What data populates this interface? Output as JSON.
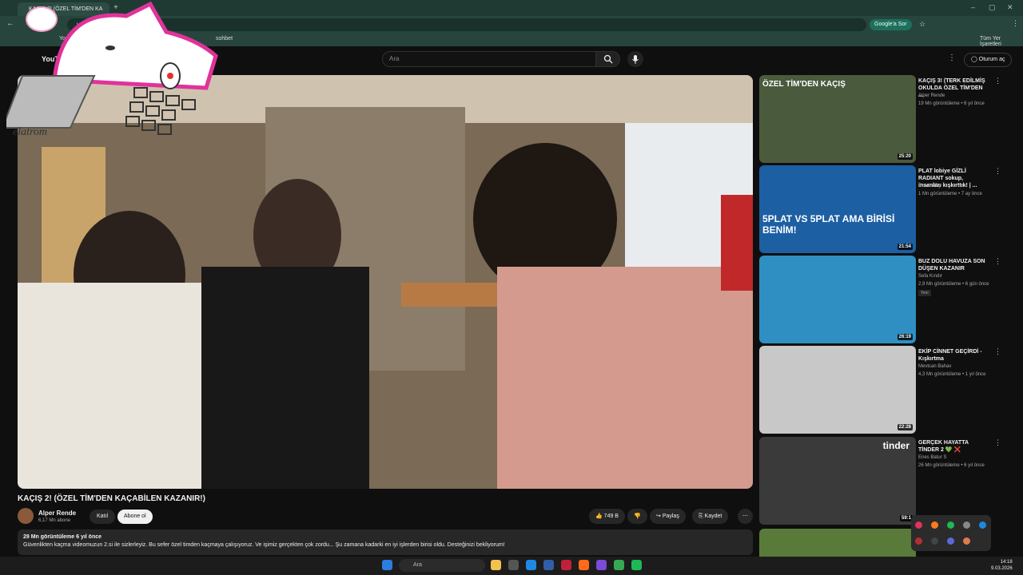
{
  "browser": {
    "tab_title": "KAÇIŞ 2! (ÖZEL TİM'DEN KA",
    "new_tab": "+",
    "url": "youtube",
    "google_sor": "Google'a Sor",
    "bookmarks": [
      "YouTube",
      "sohbet",
      "Tüm Yer İşaretleri"
    ]
  },
  "yt": {
    "logo": "YouTube",
    "search_placeholder": "Ara",
    "signin": "Oturum aç"
  },
  "overlay": {
    "text": "elatrom"
  },
  "video": {
    "title": "KAÇIŞ 2! (ÖZEL TİM'DEN KAÇABİLEN KAZANIR!)",
    "channel": "Alper Rende",
    "subs": "6,17 Mn abone",
    "join": "Katıl",
    "subscribe": "Abone ol",
    "likes": "749 B",
    "share": "Paylaş",
    "save": "Kaydet",
    "stats": "29 Mn görüntüleme  6 yıl önce",
    "description": "Güvenlikten kaçma videomuzun 2.si ile sizlerleyiz. Bu sefer özel timden kaçmaya çalışıyoruz. Ve işimiz gerçekten çok zordu... Şu zamana kadarki en iyi işlerden birisi oldu. Desteğinizi bekliyorum!"
  },
  "recommendations": [
    {
      "title": "KAÇIŞ 3! (TERK EDİLMİŞ OKULDA ÖZEL TİM'DEN ...",
      "channel": "Alper Rende",
      "meta": "19 Mn görüntüleme • 6 yıl önce",
      "duration": "25:20",
      "thumb_text": "ÖZEL TİM'DEN KAÇIŞ",
      "color": "#4a5a3c"
    },
    {
      "title": "PLAT lobiye GİZLİ RADIANT sokup, insanları kışkırttık! | ...",
      "channel": "CombatRy",
      "meta": "1 Mn görüntüleme • 7 ay önce",
      "duration": "21:54",
      "thumb_text": "5PLAT VS 5PLAT AMA BİRİSİ BENİM!",
      "color": "#1d5fa3"
    },
    {
      "title": "BUZ DOLU HAVUZA SON DÜŞEN KAZANIR",
      "channel": "Sefa Kındır",
      "meta": "2,9 Mn görüntüleme • 6 gün önce",
      "duration": "26:19",
      "badge": "Yeni",
      "color": "#2f8fc2"
    },
    {
      "title": "EKİP CİNNET GEÇİRDİ - Kışkırtma",
      "channel": "Mevtcan Bahav",
      "meta": "4,3 Mn görüntüleme • 1 yıl önce",
      "duration": "22:28",
      "color": "#c8c8c8"
    },
    {
      "title": "GERÇEK HAYATTA TİNDER 2 💚 ❌",
      "channel": "Enes Batur S",
      "meta": "26 Mn görüntüleme • 6 yıl önce",
      "duration": "59:1",
      "thumb_text": "tinder",
      "color": "#3a3a3a"
    }
  ],
  "taskbar": {
    "search": "Ara",
    "time": "14:18",
    "date": "9.03.2026"
  }
}
